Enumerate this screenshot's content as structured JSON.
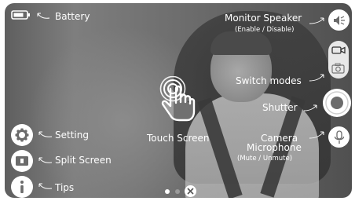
{
  "labels": {
    "battery": "Battery",
    "monitor_speaker": "Monitor Speaker",
    "monitor_speaker_sub": "(Enable / Disable)",
    "switch_modes": "Switch modes",
    "shutter": "Shutter",
    "camera_mic_line1": "Camera",
    "camera_mic_line2": "Microphone",
    "camera_mic_sub": "(Mute / Unmute)",
    "touch_screen": "Touch Screen",
    "setting": "Setting",
    "split_screen": "Split Screen",
    "tips": "Tips"
  },
  "page_indicator": {
    "total": 2,
    "current": 1
  },
  "icons": {
    "battery": "battery-icon",
    "speaker": "speaker-icon",
    "video": "video-camera-icon",
    "photo": "photo-camera-icon",
    "shutter": "shutter-icon",
    "mic": "microphone-icon",
    "gear": "gear-icon",
    "split": "split-screen-icon",
    "info": "info-icon",
    "touch": "touch-hand-icon",
    "close": "close-icon"
  },
  "colors": {
    "overlay_text": "#ffffff",
    "button_fill": "#ffffff",
    "icon_dark": "#6b6b6b"
  }
}
